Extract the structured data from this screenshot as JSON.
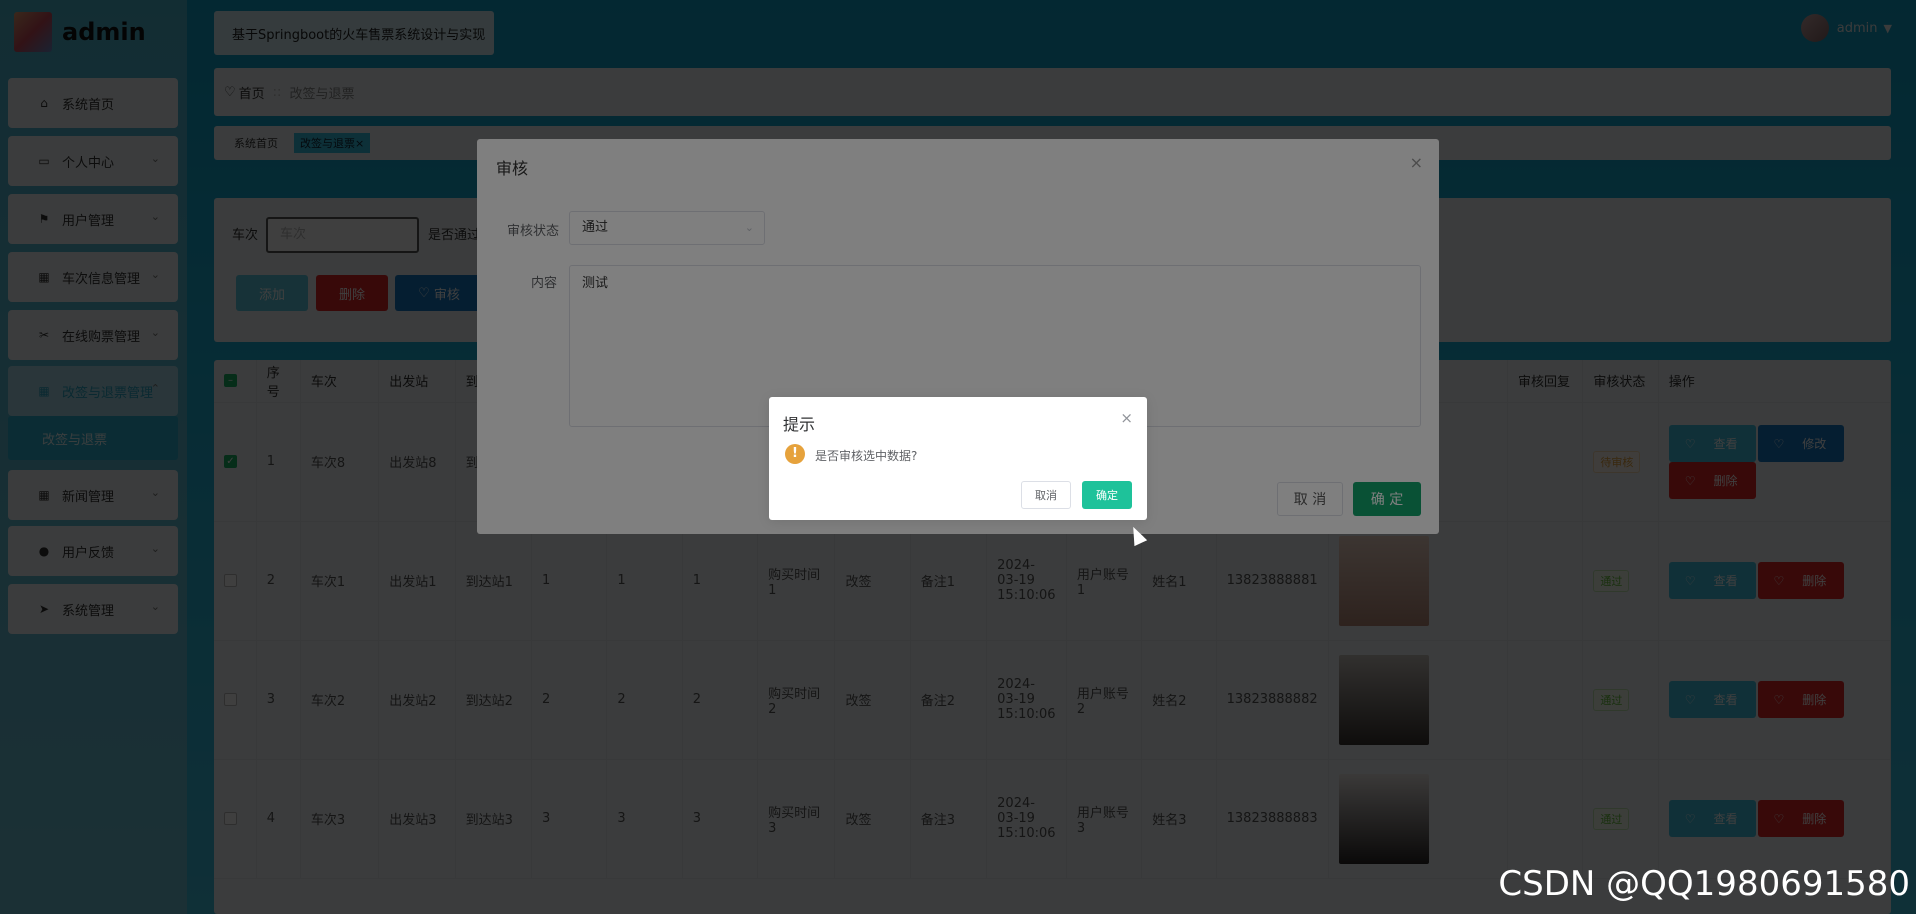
{
  "app": {
    "logo_text": "admin",
    "system_title": "基于Springboot的火车售票系统设计与实现",
    "user": "admin"
  },
  "sidebar": {
    "items": [
      {
        "label": "系统首页",
        "icon": "home-icon"
      },
      {
        "label": "个人中心",
        "icon": "card-icon"
      },
      {
        "label": "用户管理",
        "icon": "flag-icon"
      },
      {
        "label": "车次信息管理",
        "icon": "grid-icon"
      },
      {
        "label": "在线购票管理",
        "icon": "ticket-icon"
      },
      {
        "label": "改签与退票管理",
        "icon": "grid-icon"
      },
      {
        "label": "新闻管理",
        "icon": "grid-icon"
      },
      {
        "label": "用户反馈",
        "icon": "user-icon"
      },
      {
        "label": "系统管理",
        "icon": "send-icon"
      }
    ],
    "active_sub": "改签与退票"
  },
  "breadcrumb": {
    "home": "首页",
    "sep": "::",
    "current": "改签与退票"
  },
  "tags": {
    "home": "系统首页",
    "current": "改签与退票",
    "close": "×"
  },
  "search": {
    "label_train": "车次",
    "placeholder_train": "车次",
    "label_pass": "是否通过"
  },
  "actions": {
    "add": "添加",
    "delete": "删除",
    "audit": "审核"
  },
  "table": {
    "headers": {
      "index": "序号",
      "train": "车次",
      "from": "出发站",
      "to": "到",
      "reply": "审核回复",
      "status": "审核状态",
      "ops": "操作"
    },
    "rows": [
      {
        "checked": true,
        "index": "1",
        "train": "车次8",
        "from": "出发站8",
        "to": "到",
        "c1": "",
        "c2": "",
        "c3": "",
        "buy_time": "",
        "type": "",
        "note": "",
        "date": "",
        "account": "",
        "name": "",
        "phone": "",
        "has_photo": false,
        "reply": "",
        "status": "待审核",
        "status_kind": "pending",
        "ops": [
          "查看",
          "修改",
          "删除"
        ]
      },
      {
        "checked": false,
        "index": "2",
        "train": "车次1",
        "from": "出发站1",
        "to": "到达站1",
        "c1": "1",
        "c2": "1",
        "c3": "1",
        "buy_time": "购买时间1",
        "type": "改签",
        "note": "备注1",
        "date": "2024-03-19 15:10:06",
        "account": "用户账号1",
        "name": "姓名1",
        "phone": "13823888881",
        "has_photo": true,
        "photo_colors": [
          "#f1d6c8",
          "#b88a78"
        ],
        "reply": "",
        "status": "通过",
        "status_kind": "ok",
        "ops": [
          "查看",
          "删除"
        ]
      },
      {
        "checked": false,
        "index": "3",
        "train": "车次2",
        "from": "出发站2",
        "to": "到达站2",
        "c1": "2",
        "c2": "2",
        "c3": "2",
        "buy_time": "购买时间2",
        "type": "改签",
        "note": "备注2",
        "date": "2024-03-19 15:10:06",
        "account": "用户账号2",
        "name": "姓名2",
        "phone": "13823888882",
        "has_photo": true,
        "photo_colors": [
          "#c8c2bc",
          "#3a3430"
        ],
        "reply": "",
        "status": "通过",
        "status_kind": "ok",
        "ops": [
          "查看",
          "删除"
        ]
      },
      {
        "checked": false,
        "index": "4",
        "train": "车次3",
        "from": "出发站3",
        "to": "到达站3",
        "c1": "3",
        "c2": "3",
        "c3": "3",
        "buy_time": "购买时间3",
        "type": "改签",
        "note": "备注3",
        "date": "2024-03-19 15:10:06",
        "account": "用户账号3",
        "name": "姓名3",
        "phone": "13823888883",
        "has_photo": true,
        "photo_colors": [
          "#ece7e4",
          "#2a2626"
        ],
        "reply": "",
        "status": "通过",
        "status_kind": "ok",
        "ops": [
          "查看",
          "删除"
        ]
      }
    ]
  },
  "audit_dialog": {
    "title": "审核",
    "status_label": "审核状态",
    "status_value": "通过",
    "content_label": "内容",
    "content_value": "测试",
    "cancel": "取 消",
    "ok": "确 定"
  },
  "confirm": {
    "title": "提示",
    "message": "是否审核选中数据?",
    "cancel": "取消",
    "ok": "确定",
    "icon": "warning-icon"
  },
  "watermark": "CSDN @QQ1980691580",
  "colors": {
    "primary": "#1fb0d8",
    "danger": "#e02727",
    "success": "#18b565"
  }
}
